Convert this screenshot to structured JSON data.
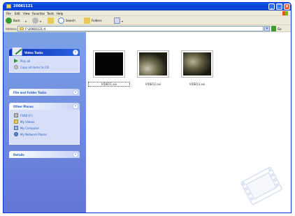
{
  "window": {
    "title": "20081121"
  },
  "title_buttons": {
    "minimize": "_",
    "maximize": "□",
    "close": "×"
  },
  "menu": [
    "File",
    "Edit",
    "View",
    "Favorites",
    "Tools",
    "Help"
  ],
  "toolbar": {
    "back": "Back",
    "search": "Search",
    "folders": "Folders"
  },
  "address": {
    "label": "Address",
    "path": "F:\\20081121-4",
    "go": "Go"
  },
  "sidebar": {
    "video_tasks": {
      "title": "Video Tasks",
      "items": [
        {
          "label": "Play all"
        },
        {
          "label": "Copy all items to CD"
        }
      ]
    },
    "file_folder_tasks": {
      "title": "File and Folder Tasks"
    },
    "other_places": {
      "title": "Other Places",
      "items": [
        {
          "label": "F4K8 (F:)"
        },
        {
          "label": "My Videos"
        },
        {
          "label": "My Computer"
        },
        {
          "label": "My Network Places"
        }
      ]
    },
    "details": {
      "title": "Details"
    }
  },
  "files": [
    {
      "name": "VIDEO1.avi",
      "selected": true
    },
    {
      "name": "VIDEO2.avi",
      "selected": false
    },
    {
      "name": "VIDEO3.avi",
      "selected": false
    }
  ],
  "colors": {
    "titlebar": "#0a48d9",
    "sidebar_top": "#7ba2e7",
    "sidebar_bottom": "#6375d6",
    "link": "#215dc6"
  }
}
